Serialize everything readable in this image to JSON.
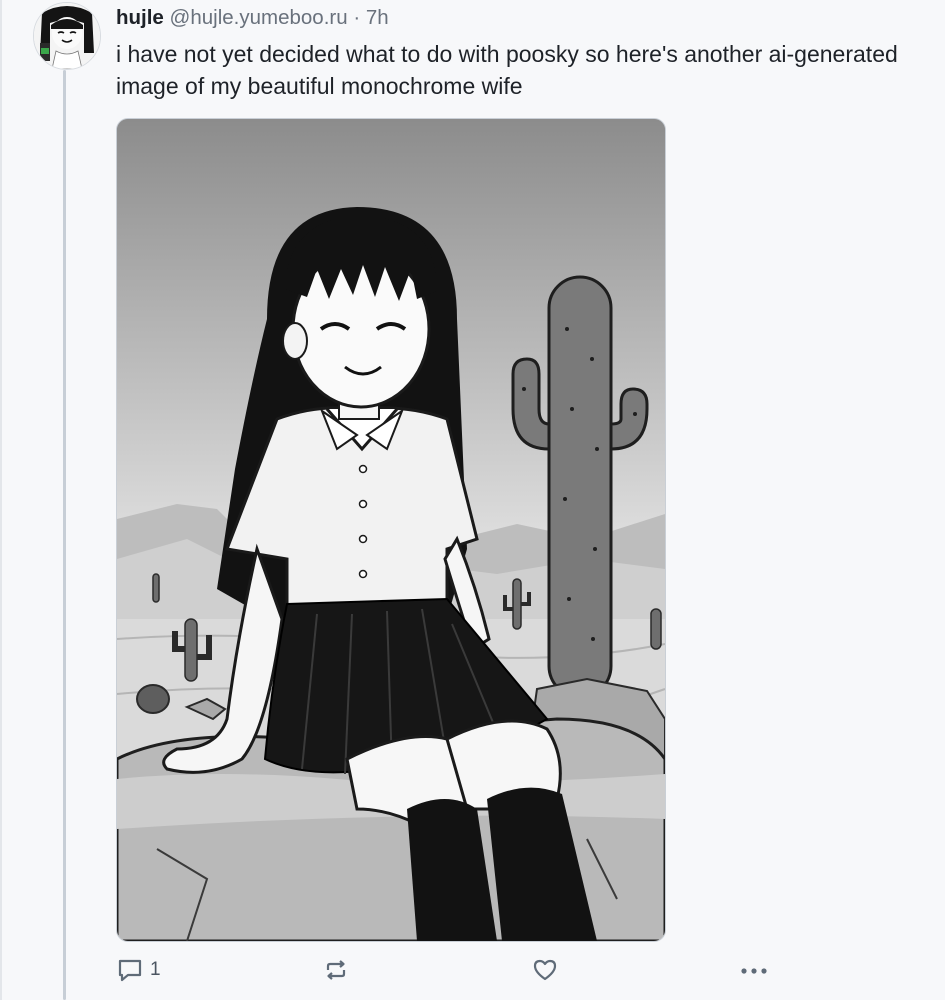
{
  "post": {
    "author": "hujle",
    "handle": "@hujle.yumeboo.ru",
    "separator": "·",
    "time": "7h",
    "text": "i have not yet decided what to do with poosky so here's another ai-generated image of my beautiful monochrome wife"
  },
  "actions": {
    "reply_count": "1",
    "reply_icon": "speech-bubble-icon",
    "repost_icon": "repost-arrows-icon",
    "like_icon": "heart-icon",
    "more_icon": "ellipsis-icon"
  },
  "colors": {
    "background": "#f7f8fa",
    "text": "#1e2228",
    "muted": "#69717c",
    "thread_line": "#c7ced6",
    "icon": "#5f6b78"
  }
}
